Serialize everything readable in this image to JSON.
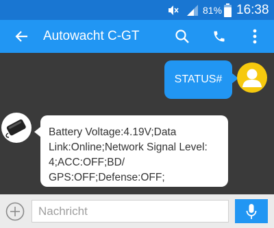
{
  "status_bar": {
    "battery_percent": "81%",
    "time": "16:38",
    "icons": [
      "mute-icon",
      "signal-icon",
      "battery-icon"
    ]
  },
  "app_bar": {
    "title": "Autowacht C-GT",
    "icons": [
      "back-arrow-icon",
      "search-icon",
      "phone-icon",
      "more-vert-icon"
    ]
  },
  "chat": {
    "outgoing": {
      "text": "STATUS#"
    },
    "incoming": {
      "lines": [
        "Battery Voltage:4.19V;Data",
        "Link:Online;Network Signal Level:",
        "4;ACC:OFF;BD/",
        "GPS:OFF;Defense:OFF;"
      ]
    }
  },
  "composer": {
    "placeholder": "Nachricht",
    "icons": [
      "add-circle-icon",
      "mic-icon"
    ]
  },
  "colors": {
    "status_bar": "#1976d2",
    "app_bar": "#2196f3",
    "chat_background": "#3a3a3a",
    "user_avatar": "#f6c90e"
  }
}
